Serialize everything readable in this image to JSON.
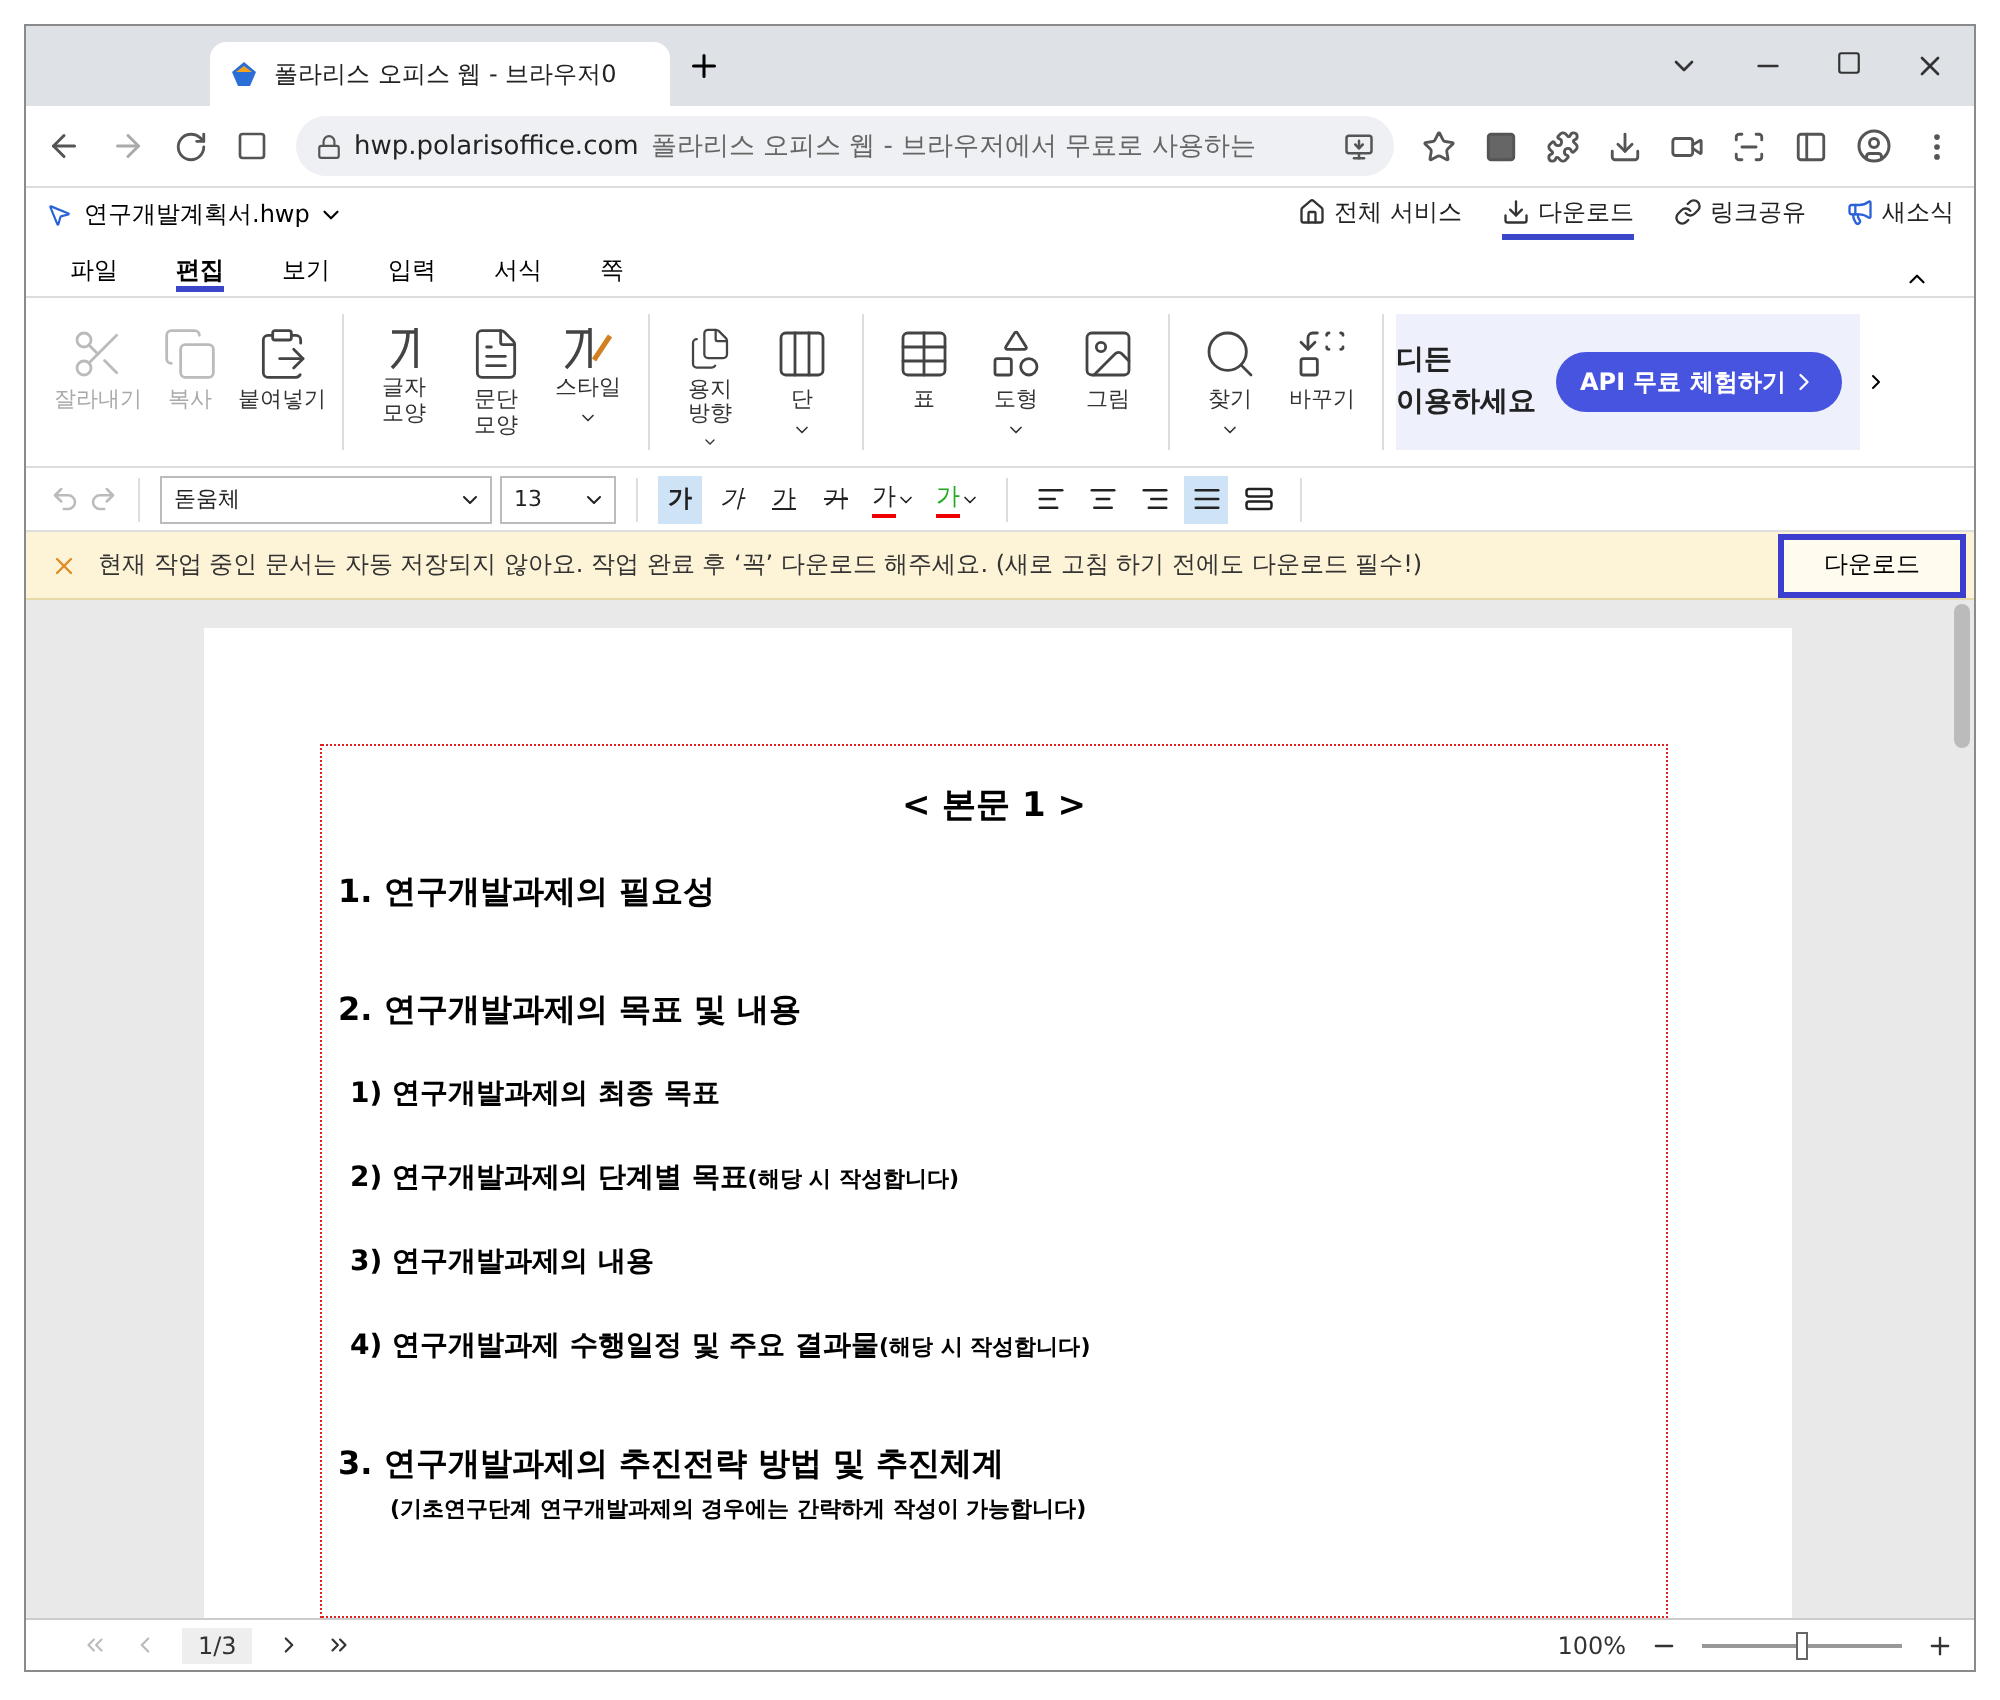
{
  "browser": {
    "tabs": [
      {
        "title": "폴라리스 오피스 웹 - 브라우저0",
        "selected": true
      }
    ],
    "url": "hwp.polarisoffice.com",
    "page_title": "폴라리스 오피스 웹 - 브라우저에서 무료로 사용하는"
  },
  "app": {
    "file_name": "연구개발계획서.hwp",
    "links": [
      {
        "label": "전체 서비스",
        "kind": "home",
        "selected": false
      },
      {
        "label": "다운로드",
        "kind": "download",
        "selected": true
      },
      {
        "label": "링크공유",
        "kind": "link",
        "selected": false
      },
      {
        "label": "새소식",
        "kind": "news",
        "selected": false
      }
    ]
  },
  "menu_tabs": [
    {
      "label": "파일",
      "selected": false
    },
    {
      "label": "편집",
      "selected": true
    },
    {
      "label": "보기",
      "selected": false
    },
    {
      "label": "입력",
      "selected": false
    },
    {
      "label": "서식",
      "selected": false
    },
    {
      "label": "쪽",
      "selected": false
    }
  ],
  "ribbon": {
    "groups": [
      [
        {
          "label": "잘라내기",
          "disabled": true,
          "menu": false
        },
        {
          "label": "복사",
          "disabled": true,
          "menu": false
        },
        {
          "label": "붙여넣기",
          "disabled": false,
          "menu": false
        }
      ],
      [
        {
          "label": "글자\n모양",
          "disabled": false,
          "menu": false
        },
        {
          "label": "문단\n모양",
          "disabled": false,
          "menu": false
        },
        {
          "label": "스타일",
          "disabled": false,
          "menu": true
        }
      ],
      [
        {
          "label": "용지\n방향",
          "disabled": false,
          "menu": true
        },
        {
          "label": "단",
          "disabled": false,
          "menu": true
        }
      ],
      [
        {
          "label": "표",
          "disabled": false,
          "menu": false
        },
        {
          "label": "도형",
          "disabled": false,
          "menu": true
        },
        {
          "label": "그림",
          "disabled": false,
          "menu": false
        }
      ],
      [
        {
          "label": "찾기",
          "disabled": false,
          "menu": true
        },
        {
          "label": "바꾸기",
          "disabled": false,
          "menu": false
        }
      ]
    ],
    "ad": {
      "line_1": "디든",
      "line_2": "이용하세요",
      "button": "API 무료 체험하기"
    }
  },
  "format_bar": {
    "font": "돋움체",
    "size": "13",
    "styles": [
      {
        "glyph": "가",
        "kind": "bold",
        "selected": true,
        "menu": false
      },
      {
        "glyph": "가",
        "kind": "italic",
        "selected": false,
        "menu": false
      },
      {
        "glyph": "가",
        "kind": "underline",
        "selected": false,
        "menu": false
      },
      {
        "glyph": "가",
        "kind": "strike",
        "selected": false,
        "menu": false
      },
      {
        "glyph": "가",
        "kind": "color",
        "selected": false,
        "menu": true
      },
      {
        "glyph": "가",
        "kind": "highlight",
        "selected": false,
        "menu": true
      }
    ],
    "aligns": [
      {
        "kind": "left",
        "selected": false
      },
      {
        "kind": "center",
        "selected": false
      },
      {
        "kind": "right",
        "selected": false
      },
      {
        "kind": "justify",
        "selected": true
      },
      {
        "kind": "distribute",
        "selected": false
      }
    ]
  },
  "notice": {
    "text": "현재 작업 중인 문서는 자동 저장되지 않아요. 작업 완료 후 ‘꼭’ 다운로드 해주세요. (새로 고침 하기 전에도 다운로드 필수!)",
    "button": "다운로드"
  },
  "document": {
    "title": "< 본문 1 >",
    "lines": [
      {
        "kind": "section",
        "number": "1.",
        "text": "연구개발과제의 필요성"
      },
      {
        "kind": "section",
        "number": "2.",
        "text": "연구개발과제의 목표 및 내용",
        "children": [
          {
            "kind": "item",
            "number": "1)",
            "text": "연구개발과제의 최종 목표"
          },
          {
            "kind": "item",
            "number": "2)",
            "text": "연구개발과제의 단계별 목표",
            "note": "(해당 시 작성합니다)"
          },
          {
            "kind": "item",
            "number": "3)",
            "text": "연구개발과제의 내용"
          },
          {
            "kind": "item",
            "number": "4)",
            "text": "연구개발과제 수행일정 및 주요 결과물",
            "note": "(해당 시 작성합니다)"
          }
        ]
      },
      {
        "kind": "section",
        "number": "3.",
        "text": "연구개발과제의 추진전략  방법 및 추진체계",
        "subtitle": "(기초연구단계 연구개발과제의 경우에는 간략하게 작성이 가능합니다)"
      }
    ]
  },
  "status_bar": {
    "page": "1/3",
    "zoom": "100%",
    "zoom_slider": {
      "level": 0.5
    }
  }
}
